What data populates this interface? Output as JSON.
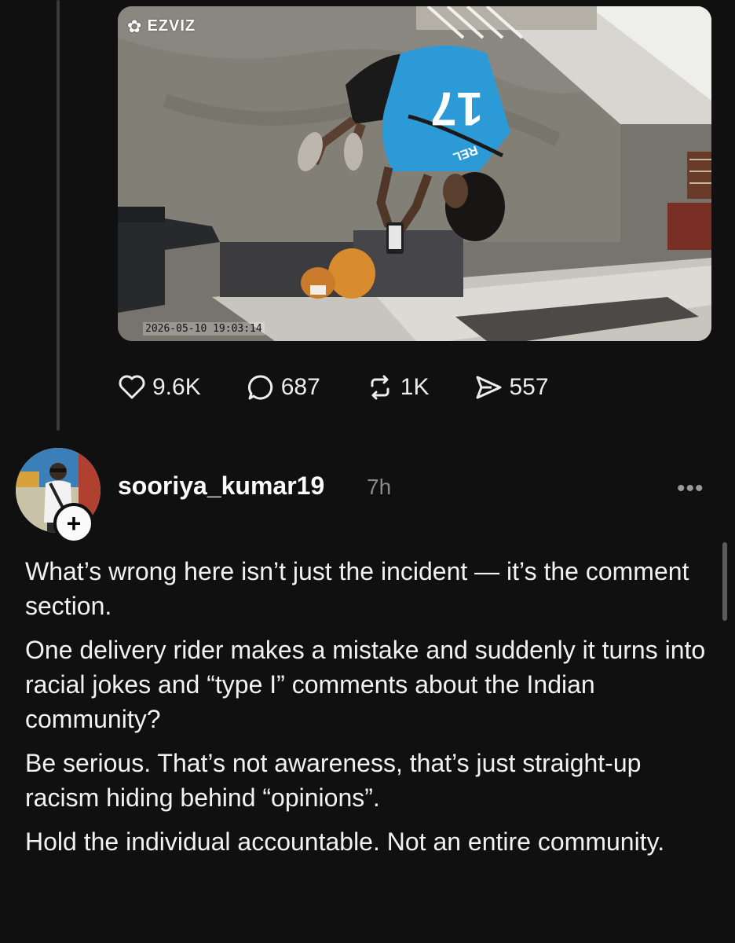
{
  "media": {
    "brand": "EZVIZ",
    "timestamp": "2026-05-10 19:03:14",
    "jersey_number": "17",
    "jersey_text": "REL"
  },
  "actions": {
    "likes": "9.6K",
    "comments": "687",
    "reposts": "1K",
    "shares": "557"
  },
  "reply": {
    "username": "sooriya_kumar19",
    "time": "7h",
    "follow_label": "+",
    "more_label": "•••",
    "paragraphs": [
      "What’s wrong here isn’t just the incident — it’s the comment section.",
      "One delivery rider makes a mistake and suddenly it turns into racial jokes and “type I” comments about the Indian community?",
      "Be serious. That’s not awareness, that’s just straight-up racism hiding behind “opinions”.",
      "Hold the individual accountable. Not an entire community."
    ]
  },
  "colors": {
    "background": "#101010",
    "text": "#f2f2f2",
    "muted": "#8a8a8a",
    "jersey": "#2d9ad8"
  }
}
